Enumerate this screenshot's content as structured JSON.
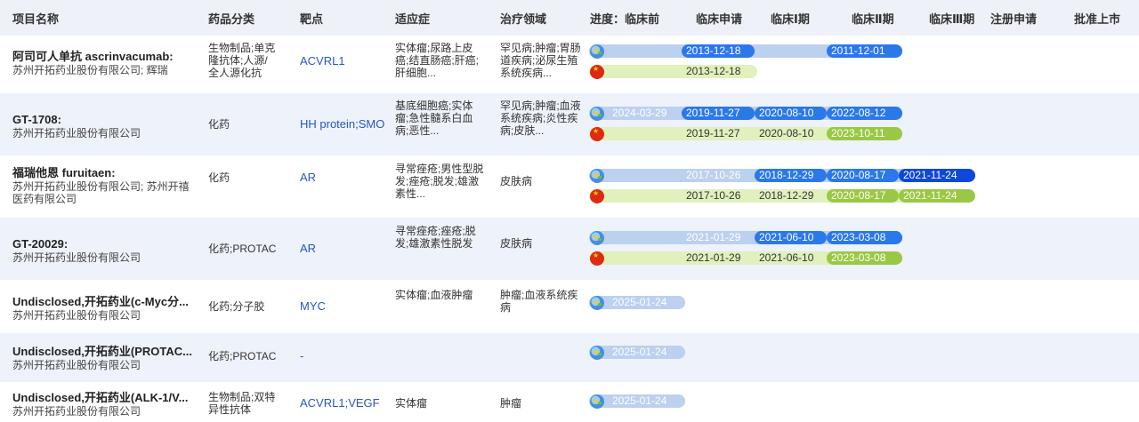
{
  "headers": [
    "项目名称",
    "药品分类",
    "靶点",
    "适应症",
    "治疗领域",
    "进度：临床前",
    "临床申请",
    "临床Ⅰ期",
    "临床Ⅱ期",
    "临床Ⅲ期",
    "注册申请",
    "批准上市"
  ],
  "colors": {
    "header_bg": "#eef1f7",
    "row_alt_bg": "#eef2fa",
    "target_link": "#2856c4",
    "global_bar_track": "#bcd0ef",
    "china_bar_track": "#e0f1bd",
    "global_segment": "#2a78ea",
    "global_segment_latest": "#0e48d8",
    "china_segment": "#9ac844"
  },
  "rows": [
    {
      "name": "阿司可人单抗 ascrinvacumab:",
      "company": "苏州开拓药业股份有限公司; 辉瑞",
      "category": "生物制品;单克隆抗体;人源/全人源化抗体;I...",
      "target": "ACVRL1",
      "indication": "实体瘤;尿路上皮癌;结直肠癌;肝癌;肝细胞...",
      "area": "罕见病;肿瘤;胃肠道疾病;泌尿生殖系统疾病...",
      "global": {
        "icon": "globe-icon",
        "dates": [
          "2013-12-18",
          "2011-12-01"
        ]
      },
      "china": {
        "icon": "china-flag-icon",
        "dates": [
          "2013-12-18"
        ]
      }
    },
    {
      "name": "GT-1708:",
      "company": "苏州开拓药业股份有限公司",
      "category": "化药",
      "target": "HH protein;SMO",
      "indication": "基底细胞癌;实体瘤;急性髓系白血病;恶性...",
      "area": "罕见病;肿瘤;血液系统疾病;炎性疾病;皮肤...",
      "global": {
        "icon": "globe-icon",
        "dates": [
          "2024-03-29",
          "2019-11-27",
          "2020-08-10",
          "2022-08-12"
        ]
      },
      "china": {
        "icon": "china-flag-icon",
        "dates": [
          "2019-11-27",
          "2020-08-10",
          "2023-10-11"
        ]
      }
    },
    {
      "name": "福瑞他恩 furuitaen:",
      "company": "苏州开拓药业股份有限公司; 苏州开禧医药有限公司",
      "category": "化药",
      "target": "AR",
      "indication": "寻常痤疮;男性型脱发;痤疮;脱发;雄激素性...",
      "area": "皮肤病",
      "global": {
        "icon": "globe-icon",
        "dates": [
          "2017-10-26",
          "2018-12-29",
          "2020-08-17",
          "2021-11-24"
        ]
      },
      "china": {
        "icon": "china-flag-icon",
        "dates": [
          "2017-10-26",
          "2018-12-29",
          "2020-08-17",
          "2021-11-24"
        ]
      }
    },
    {
      "name": "GT-20029:",
      "company": "苏州开拓药业股份有限公司",
      "category": "化药;PROTAC",
      "target": "AR",
      "indication": "寻常痤疮;痤疮;脱发;雄激素性脱发",
      "area": "皮肤病",
      "global": {
        "icon": "globe-icon",
        "dates": [
          "2021-01-29",
          "2021-06-10",
          "2023-03-08"
        ]
      },
      "china": {
        "icon": "china-flag-icon",
        "dates": [
          "2021-01-29",
          "2021-06-10",
          "2023-03-08"
        ]
      }
    },
    {
      "name": "Undisclosed,开拓药业(c-Myc分...",
      "company": "苏州开拓药业股份有限公司",
      "category": "化药;分子胶",
      "target": "MYC",
      "indication": "实体瘤;血液肿瘤",
      "area": "肿瘤;血液系统疾病",
      "global": {
        "icon": "globe-icon",
        "dates": [
          "2025-01-24"
        ]
      }
    },
    {
      "name": "Undisclosed,开拓药业(PROTAC...",
      "company": "苏州开拓药业股份有限公司",
      "category": "化药;PROTAC",
      "target": "-",
      "indication": "",
      "area": "",
      "global": {
        "icon": "globe-icon",
        "dates": [
          "2025-01-24"
        ]
      }
    },
    {
      "name": "Undisclosed,开拓药业(ALK-1/V...",
      "company": "苏州开拓药业股份有限公司",
      "category": "生物制品;双特异性抗体",
      "target": "ACVRL1;VEGF",
      "indication": "实体瘤",
      "area": "肿瘤",
      "global": {
        "icon": "globe-icon",
        "dates": [
          "2025-01-24"
        ]
      }
    }
  ]
}
